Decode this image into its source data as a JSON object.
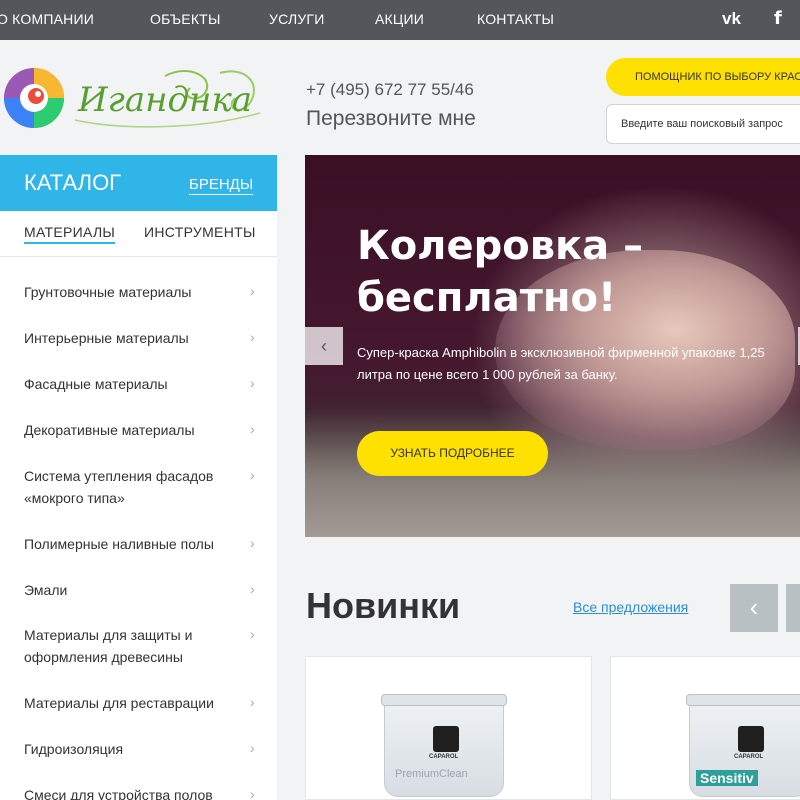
{
  "topnav": {
    "items": [
      "о компании",
      "объекты",
      "услуги",
      "акции",
      "контакты"
    ],
    "social": [
      {
        "icon": "vk-icon",
        "glyph": "vk"
      },
      {
        "icon": "facebook-icon",
        "glyph": "f"
      }
    ]
  },
  "header": {
    "logo_text": "Иганднка",
    "phone": "+7 (495) 672 77 55/46",
    "callback": "Перезвоните мне",
    "helper_button": "ПОМОЩНИК ПО ВЫБОРУ КРАСК",
    "search_placeholder": "Введите ваш поисковый запрос"
  },
  "sidebar": {
    "catalog": "КАТАЛОГ",
    "brands": "БРЕНДЫ",
    "tabs": [
      {
        "label": "МАТЕРИАЛЫ",
        "active": true
      },
      {
        "label": "ИНСТРУМЕНТЫ",
        "active": false
      }
    ],
    "items": [
      "Грунтовочные материалы",
      "Интерьерные материалы",
      "Фасадные материалы",
      "Декоративные материалы",
      "Система утепления фасадов «мокрого типа»",
      "Полимерные наливные полы",
      "Эмали",
      "Материалы для защиты и оформления древесины",
      "Материалы для реставрации",
      "Гидроизоляция",
      "Смеси для устройства полов"
    ],
    "chevron": "›"
  },
  "banner": {
    "title_line1": "Колеровка –",
    "title_line2": "бесплатно!",
    "description": "Супер-краска Amphibolin в эксклюзивной фирменной упаковке 1,25 литра по цене всего 1 000 рублей за банку.",
    "button": "УЗНАТЬ ПОДРОБНЕЕ",
    "prev_glyph": "‹"
  },
  "new_products": {
    "title": "Новинки",
    "all_offers": "Все предложения",
    "prev_glyph": "‹",
    "products": [
      {
        "brand": "CAPAROL",
        "name": "PremiumClean"
      },
      {
        "brand": "CAPAROL",
        "name": "Sensitiv"
      }
    ]
  },
  "colors": {
    "nav_bg": "#53575c",
    "catalog_blue": "#30b5e9",
    "accent_yellow": "#ffe100",
    "link_blue": "#2c8fd1"
  }
}
